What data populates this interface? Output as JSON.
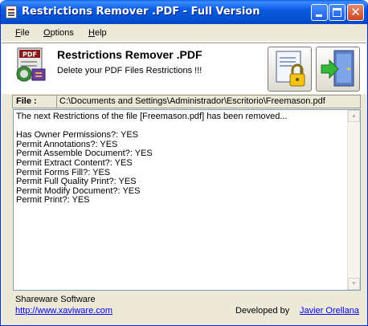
{
  "window": {
    "title": "Restrictions Remover .PDF - Full Version"
  },
  "menu": [
    {
      "label_first": "F",
      "label_rest": "ile"
    },
    {
      "label_first": "O",
      "label_rest": "ptions"
    },
    {
      "label_first": "H",
      "label_rest": "elp"
    }
  ],
  "header": {
    "logo_text": "PDF",
    "app_name": "Restrictions Remover .PDF",
    "description": "Delete your PDF Files Restrictions !!!"
  },
  "file": {
    "label": "File :",
    "path": "C:\\Documents and Settings\\Administrador\\Escritorio\\Freemason.pdf"
  },
  "log": {
    "text": "The next Restrictions of the file [Freemason.pdf] has been removed...\n\nHas Owner Permissions?: YES\nPermit Annotations?: YES\nPermit Assemble Document?: YES\nPermit Extract Content?: YES\nPermit Forms Fill?: YES\nPermit Full Quality Print?: YES\nPermit Modify Document?: YES\nPermit Print?: YES"
  },
  "footer": {
    "shareware": "Shareware Software",
    "website": "http://www.xaviware.com",
    "developed_by": "Developed by",
    "developer": "Javier Orellana"
  },
  "colors": {
    "titlebar": "#0453d6",
    "window_bg": "#ece9d8",
    "link": "#0000ee"
  }
}
